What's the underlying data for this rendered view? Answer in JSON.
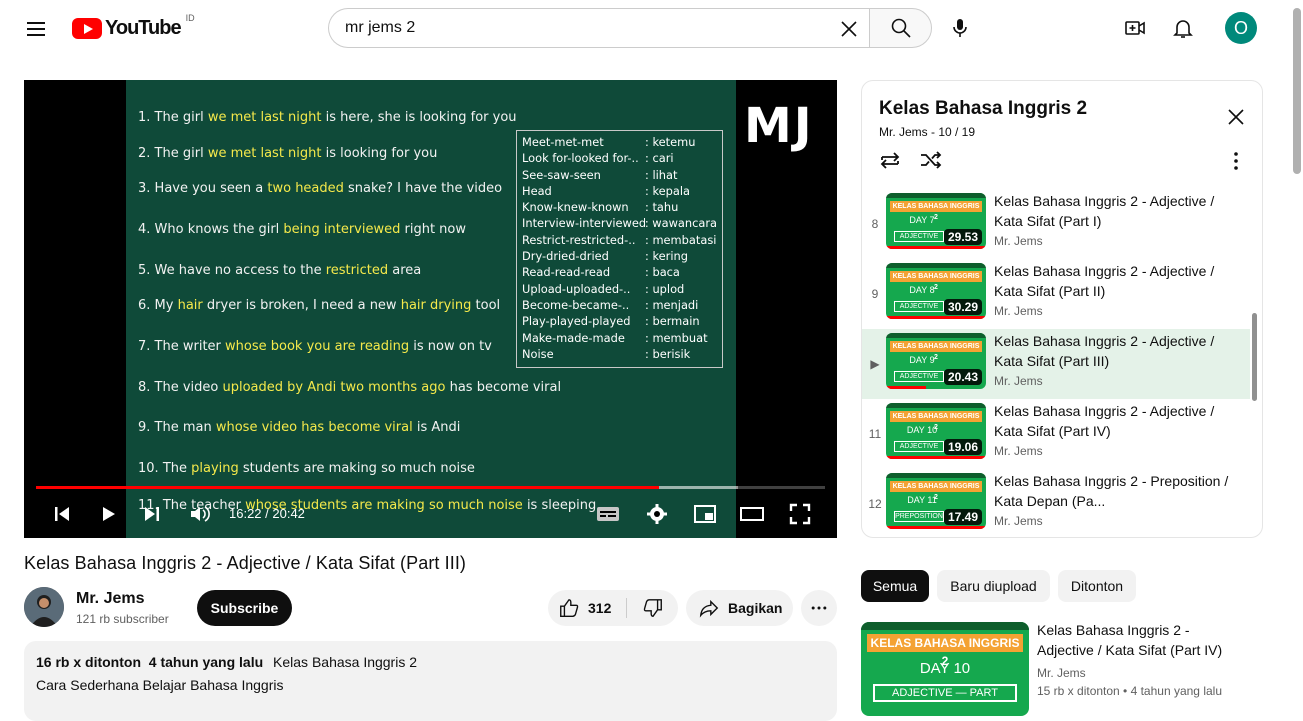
{
  "header": {
    "logo_text": "YouTube",
    "country_code": "ID",
    "search_value": "mr jems 2"
  },
  "icons": {
    "menu": "hamburger-icon",
    "search": "search-icon",
    "clear": "close-icon",
    "mic": "mic-icon",
    "create": "create-video-icon",
    "notifications": "bell-icon"
  },
  "user": {
    "avatar_initial": "O",
    "avatar_color": "#00897b"
  },
  "player": {
    "time_current": "16:22",
    "time_total": "20:42",
    "time_display": "16:22 / 20:42",
    "played_fraction": 0.79,
    "buffered_fraction": 0.89,
    "watermark": "MJ",
    "board_lines": [
      {
        "n": "1.",
        "parts": [
          [
            "The girl ",
            false
          ],
          [
            "we met last night",
            true
          ],
          [
            " is here, she is looking for you",
            false
          ]
        ]
      },
      {
        "n": "2.",
        "parts": [
          [
            "The girl ",
            false
          ],
          [
            "we met last night",
            true
          ],
          [
            " is looking for you",
            false
          ]
        ]
      },
      {
        "n": "3.",
        "parts": [
          [
            "Have you seen a ",
            false
          ],
          [
            "two headed",
            true
          ],
          [
            " snake? I have the video",
            false
          ]
        ]
      },
      {
        "n": "4.",
        "parts": [
          [
            "Who knows the girl ",
            false
          ],
          [
            "being interviewed",
            true
          ],
          [
            " right now",
            false
          ]
        ]
      },
      {
        "n": "5.",
        "parts": [
          [
            "We have no access to the ",
            false
          ],
          [
            "restricted",
            true
          ],
          [
            " area",
            false
          ]
        ]
      },
      {
        "n": "6.",
        "parts": [
          [
            "My ",
            false
          ],
          [
            "hair",
            true
          ],
          [
            " dryer is broken, I need a new ",
            false
          ],
          [
            "hair drying",
            true
          ],
          [
            " tool",
            false
          ]
        ]
      },
      {
        "n": "7.",
        "parts": [
          [
            "The writer ",
            false
          ],
          [
            "whose book you are reading",
            true
          ],
          [
            " is now on tv",
            false
          ]
        ]
      },
      {
        "n": "8.",
        "parts": [
          [
            "The video ",
            false
          ],
          [
            "uploaded by Andi two months ago",
            true
          ],
          [
            " has become viral",
            false
          ]
        ]
      },
      {
        "n": "9.",
        "parts": [
          [
            "The man ",
            false
          ],
          [
            "whose video has become viral",
            true
          ],
          [
            " is Andi",
            false
          ]
        ]
      },
      {
        "n": "10.",
        "parts": [
          [
            "The ",
            false
          ],
          [
            "playing",
            true
          ],
          [
            " students are making so much noise",
            false
          ]
        ]
      },
      {
        "n": "11.",
        "parts": [
          [
            "The teacher ",
            false
          ],
          [
            "whose students are making so much noise",
            true
          ],
          [
            " is sleeping",
            false
          ]
        ]
      }
    ],
    "vocab": [
      [
        "Meet-met-met",
        ": ketemu"
      ],
      [
        "Look for-looked for-..",
        ": cari"
      ],
      [
        "See-saw-seen",
        ": lihat"
      ],
      [
        "Head",
        ": kepala"
      ],
      [
        "Know-knew-known",
        ": tahu"
      ],
      [
        "Interview-interviewed",
        ": wawancara"
      ],
      [
        "Restrict-restricted-..",
        ": membatasi"
      ],
      [
        "Dry-dried-dried",
        ": kering"
      ],
      [
        "Read-read-read",
        ": baca"
      ],
      [
        "Upload-uploaded-..",
        ": uplod"
      ],
      [
        "Become-became-..",
        ": menjadi"
      ],
      [
        "Play-played-played",
        ": bermain"
      ],
      [
        "Make-made-made",
        ": membuat"
      ],
      [
        "Noise",
        ": berisik"
      ]
    ]
  },
  "playlist": {
    "title": "Kelas Bahasa Inggris 2",
    "subtitle": "Mr. Jems - 10 / 19",
    "items": [
      {
        "index": "8",
        "title": "Kelas Bahasa Inggris 2 - Adjective / Kata Sifat (Part I)",
        "channel": "Mr. Jems",
        "duration": "29.53",
        "thumb_band": "KELAS BAHASA INGGRIS 2",
        "thumb_day": "DAY 7",
        "thumb_cat": "ADJECTIVE",
        "active": false,
        "watched": 1.0
      },
      {
        "index": "9",
        "title": "Kelas Bahasa Inggris 2 - Adjective / Kata Sifat (Part II)",
        "channel": "Mr. Jems",
        "duration": "30.29",
        "thumb_band": "KELAS BAHASA INGGRIS 2",
        "thumb_day": "DAY 8",
        "thumb_cat": "ADJECTIVE",
        "active": false,
        "watched": 1.0
      },
      {
        "index": "▶",
        "title": "Kelas Bahasa Inggris 2 - Adjective / Kata Sifat (Part III)",
        "channel": "Mr. Jems",
        "duration": "20.43",
        "thumb_band": "KELAS BAHASA INGGRIS 2",
        "thumb_day": "DAY 9",
        "thumb_cat": "ADJECTIVE",
        "active": true,
        "watched": 0.4
      },
      {
        "index": "11",
        "title": "Kelas Bahasa Inggris 2 - Adjective / Kata Sifat (Part IV)",
        "channel": "Mr. Jems",
        "duration": "19.06",
        "thumb_band": "KELAS BAHASA INGGRIS 2",
        "thumb_day": "DAY 10",
        "thumb_cat": "ADJECTIVE",
        "active": false,
        "watched": 1.0
      },
      {
        "index": "12",
        "title": "Kelas Bahasa Inggris 2 - Preposition / Kata Depan (Pa...",
        "channel": "Mr. Jems",
        "duration": "17.49",
        "thumb_band": "KELAS BAHASA INGGRIS 2",
        "thumb_day": "DAY 11",
        "thumb_cat": "PREPOSITION",
        "active": false,
        "watched": 1.0
      }
    ]
  },
  "video": {
    "title": "Kelas Bahasa Inggris 2 - Adjective / Kata Sifat (Part III)",
    "channel": "Mr. Jems",
    "subscribers": "121 rb subscriber",
    "subscribe_label": "Subscribe",
    "likes": "312",
    "share_label": "Bagikan",
    "views": "16 rb x ditonton",
    "age": "4 tahun yang lalu",
    "tag": "Kelas Bahasa Inggris 2",
    "description": "Cara Sederhana Belajar Bahasa Inggris"
  },
  "chips": [
    "Semua",
    "Baru diupload",
    "Ditonton"
  ],
  "recommendation": {
    "title": "Kelas Bahasa Inggris 2 - Adjective / Kata Sifat (Part IV)",
    "channel": "Mr. Jems",
    "views": "15 rb x ditonton",
    "age": "4 tahun yang lalu",
    "meta": "15 rb x ditonton  • 4 tahun yang lalu",
    "thumb_band": "KELAS BAHASA INGGRIS 2",
    "thumb_day": "DAY 10",
    "thumb_cat": "ADJECTIVE — PART"
  },
  "colors": {
    "brand_red": "#ff0000",
    "board_green": "#0f4a39",
    "highlight_yellow": "#f5e94b",
    "thumb_green": "#15a84e",
    "thumb_orange": "#f4a233"
  }
}
